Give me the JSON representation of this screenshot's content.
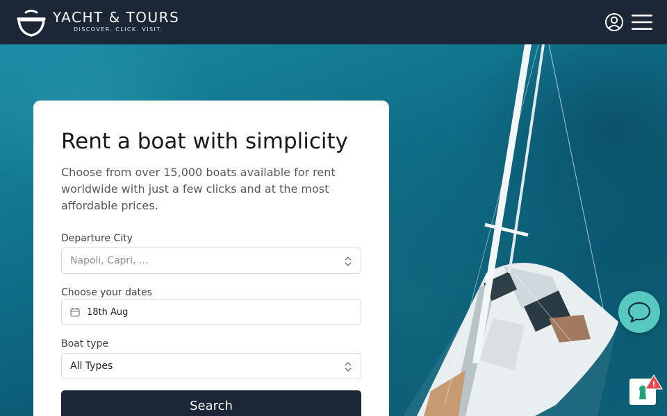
{
  "header": {
    "brand_name": "YACHT & TOURS",
    "tagline": "DISCOVER. CLICK. VISIT.",
    "icons": [
      "boat-logo",
      "user-icon",
      "menu-icon"
    ]
  },
  "search_card": {
    "title": "Rent a boat with simplicity",
    "description": "Choose from over 15,000 boats available for rent worldwide with just a few clicks and at the most affordable prices.",
    "departure_label": "Departure City",
    "departure_placeholder": "Napoli, Capri, ...",
    "dates_label": "Choose your dates",
    "dates_value": "18th Aug",
    "boat_type_label": "Boat type",
    "boat_type_value": "All Types",
    "search_label": "Search"
  },
  "widgets": {
    "chat_icon": "chat-bubble-icon",
    "cookie_icon": "keyhole-icon",
    "alert_text": "!"
  },
  "colors": {
    "header_bg": "#1b2637",
    "accent_chat": "#57c9c0",
    "button_bg": "#1b2637",
    "alert": "#e5484d"
  }
}
